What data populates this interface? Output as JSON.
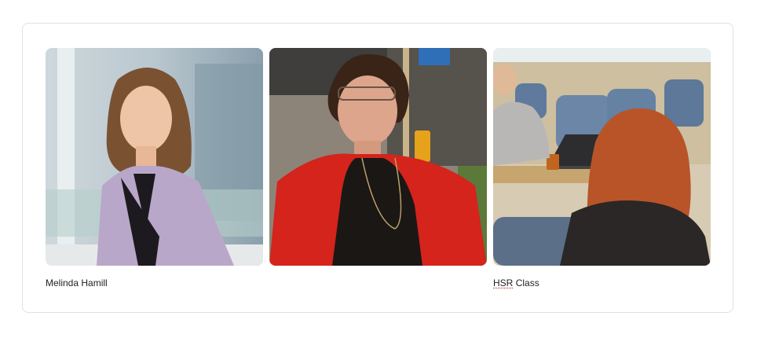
{
  "gallery": {
    "items": [
      {
        "caption": "Melinda Hamill",
        "image": "portrait-woman-lilac-blazer"
      },
      {
        "caption": "",
        "image": "woman-red-jacket-outdoors"
      },
      {
        "caption_word1": "HSR",
        "caption_word2": "Class",
        "image": "classroom-students"
      }
    ]
  },
  "colors": {
    "card_border": "#e1e1e1",
    "caption_text": "#222222",
    "spellcheck_underline": "#d22a2a"
  }
}
